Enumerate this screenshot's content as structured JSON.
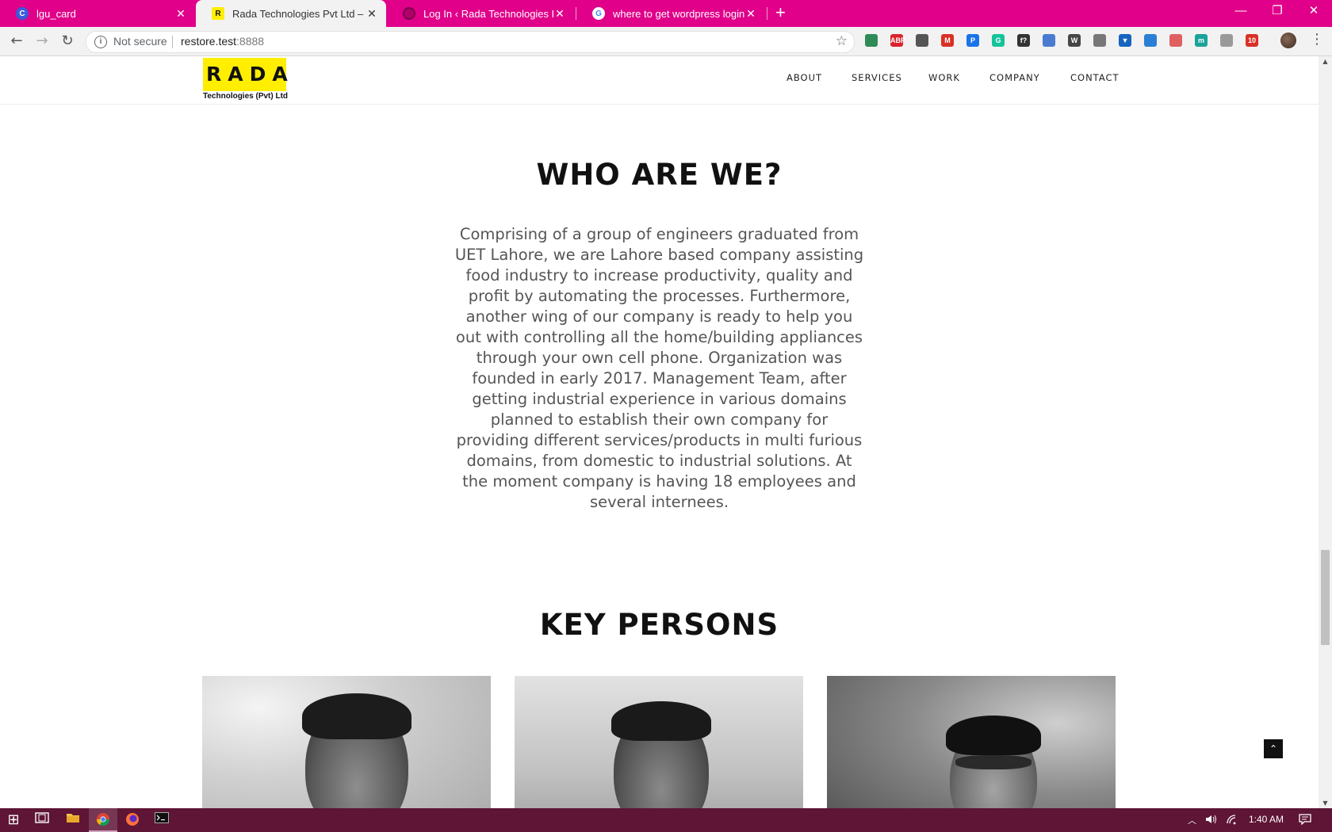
{
  "browser": {
    "tabs": [
      {
        "title": "lgu_card",
        "favicon": "C",
        "favicon_color": "#3b5bdb"
      },
      {
        "title": "Rada Technologies Pvt Ltd – Auto",
        "favicon": "R",
        "favicon_color": "#ffee00"
      },
      {
        "title": "Log In ‹ Rada Technologies Pvt Lt",
        "favicon": "",
        "favicon_color": "#b0006a"
      },
      {
        "title": "where to get wordpress login pa",
        "favicon": "G",
        "favicon_color": "#ffffff"
      }
    ],
    "close_glyph": "✕",
    "new_tab_glyph": "+",
    "minimize_glyph": "—",
    "restore_glyph": "❐",
    "close_window_glyph": "✕",
    "back_glyph": "←",
    "forward_glyph": "→",
    "reload_glyph": "↻",
    "security_label": "Not secure",
    "url_host": "restore.test",
    "url_port": ":8888",
    "bookmark_glyph": "☆",
    "menu_glyph": "⋮",
    "extensions": [
      {
        "name": "globe-ext-icon",
        "color": "#2e8b57",
        "label": ""
      },
      {
        "name": "adblock-plus-icon",
        "color": "#d9232d",
        "label": "ABP"
      },
      {
        "name": "shield-ext-icon",
        "color": "#555555",
        "label": ""
      },
      {
        "name": "gmail-icon",
        "color": "#d93025",
        "label": "M"
      },
      {
        "name": "pushbullet-icon",
        "color": "#1a73e8",
        "label": "P"
      },
      {
        "name": "grammarly-icon",
        "color": "#15c39a",
        "label": "G"
      },
      {
        "name": "whatfont-icon",
        "color": "#333333",
        "label": "f?"
      },
      {
        "name": "puzzle-ext-icon",
        "color": "#4a7bd0",
        "label": ""
      },
      {
        "name": "wordpress-icon",
        "color": "#464646",
        "label": "W"
      },
      {
        "name": "eyedropper-icon",
        "color": "#777777",
        "label": ""
      },
      {
        "name": "pocket-download-icon",
        "color": "#1565c0",
        "label": "▼"
      },
      {
        "name": "window-ext-icon",
        "color": "#2a7fd4",
        "label": ""
      },
      {
        "name": "ublock-icon",
        "color": "#e06060",
        "label": ""
      },
      {
        "name": "m-ext-icon",
        "color": "#1aa39a",
        "label": "m"
      },
      {
        "name": "font-ext-icon",
        "color": "#999999",
        "label": ""
      },
      {
        "name": "calendar-ext-icon",
        "color": "#d93025",
        "label": "10"
      }
    ]
  },
  "site": {
    "logo_text": "RADA",
    "logo_sub": "Technologies (Pvt) Ltd",
    "brand_color": "#ffee00",
    "nav": [
      "ABOUT",
      "SERVICES",
      "WORK",
      "COMPANY",
      "CONTACT"
    ],
    "about_title": "WHO ARE WE?",
    "about_text": "Comprising of a group of engineers graduated from UET Lahore, we are Lahore based company assisting food industry to increase productivity, quality and profit by automating the processes. Furthermore, another wing of our company is ready to help you out with controlling all the home/building appliances through your own cell phone. Organization was founded in early 2017. Management Team, after getting industrial experience in various domains planned to establish their own company for providing different services/products in multi furious domains, from domestic to industrial solutions. At the moment company is having 18 employees and several internees.",
    "key_persons_title": "KEY PERSONS",
    "scroll_top_glyph": "⌃"
  },
  "taskbar": {
    "time": "1:40 AM",
    "start_glyph": "⊞"
  }
}
